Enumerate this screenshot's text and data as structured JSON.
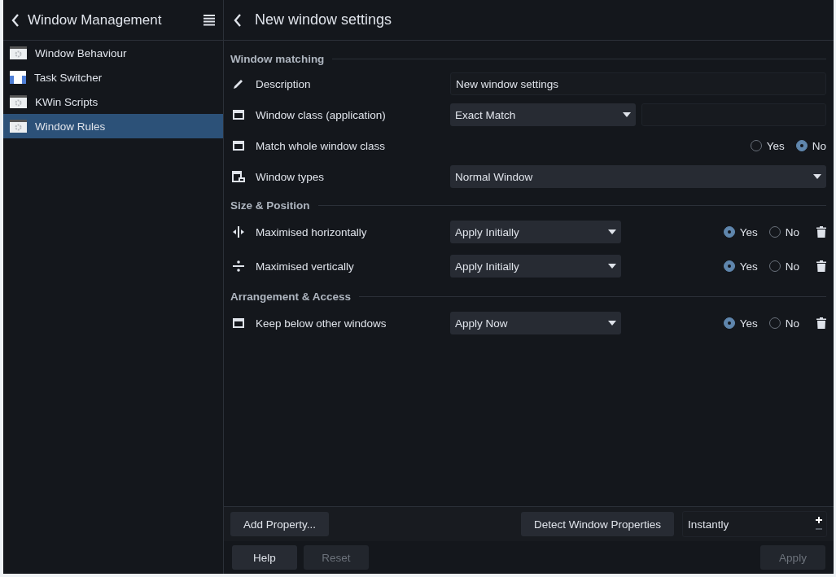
{
  "sidebar": {
    "title": "Window Management",
    "items": [
      {
        "label": "Window Behaviour",
        "selected": false
      },
      {
        "label": "Task Switcher",
        "selected": false
      },
      {
        "label": "KWin Scripts",
        "selected": false
      },
      {
        "label": "Window Rules",
        "selected": true
      }
    ]
  },
  "page": {
    "title": "New window settings"
  },
  "sections": [
    {
      "title": "Window matching",
      "rows": [
        {
          "label": "Description",
          "kind": "text",
          "value": "New window settings"
        },
        {
          "label": "Window class (application)",
          "kind": "combo-text",
          "value": "Exact Match"
        },
        {
          "label": "Match whole window class",
          "kind": "radio",
          "options": [
            {
              "label": "Yes",
              "selected": false
            },
            {
              "label": "No",
              "selected": true
            }
          ]
        },
        {
          "label": "Window types",
          "kind": "combo-wide",
          "value": "Normal Window"
        }
      ]
    },
    {
      "title": "Size & Position",
      "rows": [
        {
          "label": "Maximised horizontally",
          "kind": "combo-radio",
          "value": "Apply Initially",
          "options": [
            {
              "label": "Yes",
              "selected": true
            },
            {
              "label": "No",
              "selected": false
            }
          ],
          "removable": true
        },
        {
          "label": "Maximised vertically",
          "kind": "combo-radio",
          "value": "Apply Initially",
          "options": [
            {
              "label": "Yes",
              "selected": true
            },
            {
              "label": "No",
              "selected": false
            }
          ],
          "removable": true
        }
      ]
    },
    {
      "title": "Arrangement & Access",
      "rows": [
        {
          "label": "Keep below other windows",
          "kind": "combo-radio",
          "value": "Apply Now",
          "options": [
            {
              "label": "Yes",
              "selected": true
            },
            {
              "label": "No",
              "selected": false
            }
          ],
          "removable": true
        }
      ]
    }
  ],
  "footer": {
    "add_button": "Add Property...",
    "detect_button": "Detect Window Properties",
    "delay": "Instantly"
  },
  "buttons": [
    {
      "label": "Help",
      "disabled": false
    },
    {
      "label": "Reset",
      "disabled": true
    },
    {
      "label": "Apply",
      "disabled": true
    }
  ]
}
